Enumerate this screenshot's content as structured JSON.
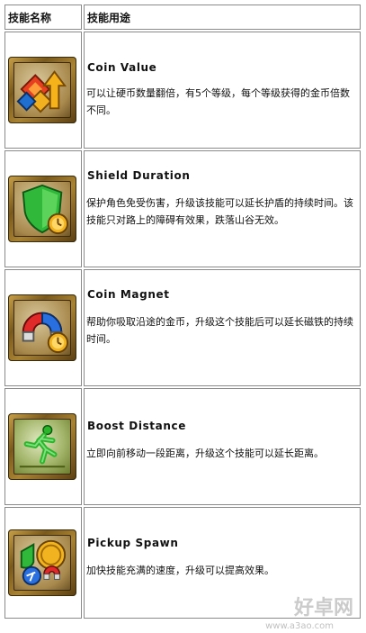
{
  "table": {
    "header": {
      "col_name": "技能名称",
      "col_use": "技能用途"
    },
    "rows": [
      {
        "name": "Coin Value",
        "desc": "可以让硬币数量翻倍，有5个等级，每个等级获得的金币倍数不同。",
        "icon": "coin-value-icon"
      },
      {
        "name": "Shield Duration",
        "desc": "保护角色免受伤害，升级该技能可以延长护盾的持续时间。该技能只对路上的障碍有效果，跌落山谷无效。",
        "icon": "shield-duration-icon"
      },
      {
        "name": "Coin Magnet",
        "desc": "帮助你吸取沿途的金币，升级这个技能后可以延长磁铁的持续时间。",
        "icon": "coin-magnet-icon"
      },
      {
        "name": "Boost Distance",
        "desc": "立即向前移动一段距离，升级这个技能可以延长距离。",
        "icon": "boost-distance-icon"
      },
      {
        "name": "Pickup Spawn",
        "desc": "加快技能充满的速度，升级可以提高效果。",
        "icon": "pickup-spawn-icon"
      }
    ]
  },
  "watermark": {
    "text": "好卓网",
    "url": "www.a3ao.com"
  }
}
